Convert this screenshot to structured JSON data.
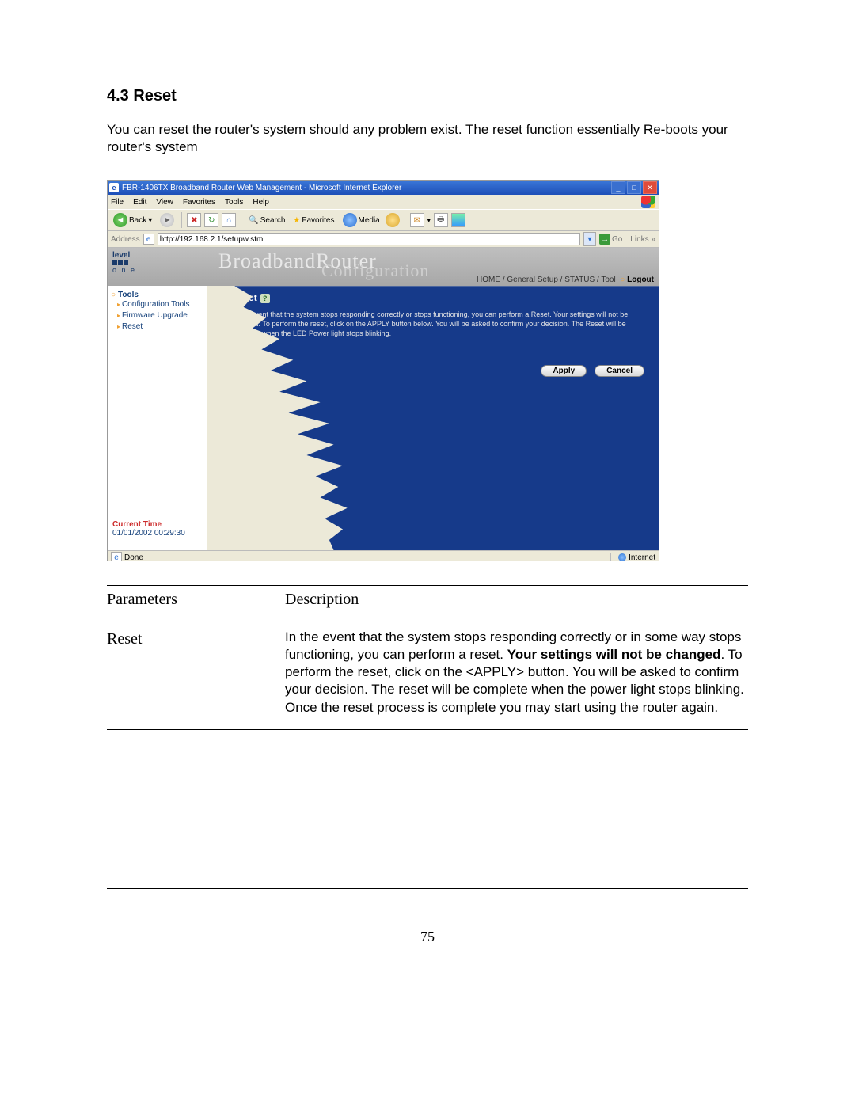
{
  "doc": {
    "section_title": "4.3 Reset",
    "intro": "You can reset the router's system should any problem exist. The reset function essentially Re-boots your router's system",
    "page_number": "75",
    "table": {
      "head_param": "Parameters",
      "head_desc": "Description",
      "row_param": "Reset",
      "row_desc_1": "In the event that the system stops responding correctly or in some way stops functioning, you can perform a reset. ",
      "row_desc_bold": "Your settings will not be changed",
      "row_desc_2": ". To perform the reset, click on the <APPLY> button. You will be asked to confirm your decision. The reset will be complete when the power light stops blinking. Once the reset process is complete you may start using the router again."
    }
  },
  "ie": {
    "title": "FBR-1406TX Broadband Router Web Management - Microsoft Internet Explorer",
    "menu": [
      "File",
      "Edit",
      "View",
      "Favorites",
      "Tools",
      "Help"
    ],
    "toolbar": {
      "back": "Back",
      "search": "Search",
      "favorites": "Favorites",
      "media": "Media"
    },
    "address_label": "Address",
    "address_value": "http://192.168.2.1/setupw.stm",
    "go": "Go",
    "links": "Links",
    "status_done": "Done",
    "status_zone": "Internet"
  },
  "router": {
    "logo_top": "level",
    "logo_bottom": "o n e",
    "banner1": "BroadbandRouter",
    "banner2": "Configuration",
    "nav": {
      "home": "HOME",
      "sep": " / ",
      "gs": "General Setup",
      "status": "STATUS",
      "tool": "Tool",
      "logout": "Logout"
    },
    "side": {
      "tools": "Tools",
      "items": [
        "Configuration Tools",
        "Firmware Upgrade",
        "Reset"
      ]
    },
    "main": {
      "heading": "Reset",
      "desc": "In the event that the system stops responding correctly or stops functioning, you can perform a Reset. Your settings will not be changed. To perform the reset, click on the APPLY button below. You will be asked to confirm your decision. The Reset will be complete when the LED Power light stops blinking.",
      "apply": "Apply",
      "cancel": "Cancel"
    },
    "time_label": "Current Time",
    "time_value": "01/01/2002 00:29:30"
  }
}
